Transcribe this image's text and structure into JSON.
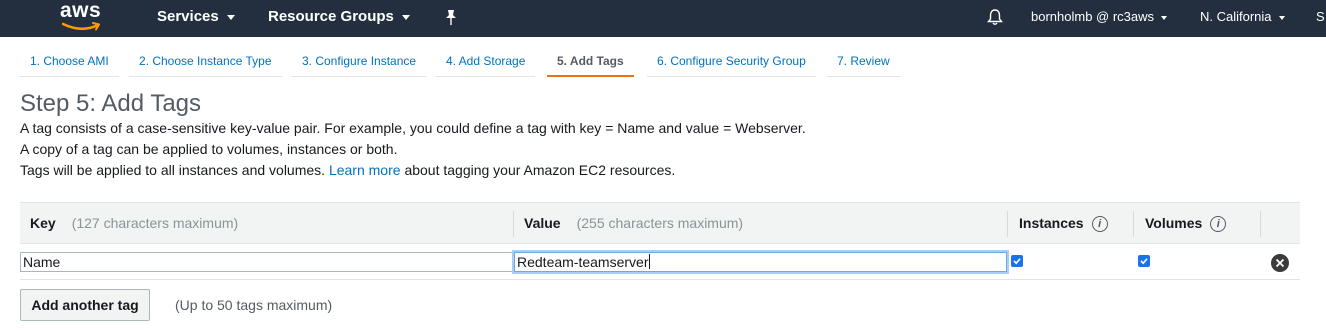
{
  "topnav": {
    "logo_text": "aws",
    "services": "Services",
    "resource_groups": "Resource Groups",
    "account": "bornholmb @ rc3aws",
    "region": "N. California",
    "support_partial": "S"
  },
  "wizard": {
    "steps": [
      {
        "label": "1. Choose AMI"
      },
      {
        "label": "2. Choose Instance Type"
      },
      {
        "label": "3. Configure Instance"
      },
      {
        "label": "4. Add Storage"
      },
      {
        "label": "5. Add Tags"
      },
      {
        "label": "6. Configure Security Group"
      },
      {
        "label": "7. Review"
      }
    ],
    "active_index": 4
  },
  "page": {
    "title": "Step 5: Add Tags",
    "line1": "A tag consists of a case-sensitive key-value pair. For example, you could define a tag with key = Name and value = Webserver.",
    "line2": "A copy of a tag can be applied to volumes, instances or both.",
    "line3_pre": "Tags will be applied to all instances and volumes.",
    "line3_link": "Learn more",
    "line3_post": "about tagging your Amazon EC2 resources."
  },
  "table": {
    "headers": {
      "key": "Key",
      "key_hint": "(127 characters maximum)",
      "value": "Value",
      "value_hint": "(255 characters maximum)",
      "instances": "Instances",
      "volumes": "Volumes"
    },
    "rows": [
      {
        "key": "Name",
        "value": "Redteam-teamserver",
        "instances": true,
        "volumes": true
      }
    ]
  },
  "actions": {
    "add_tag": "Add another tag",
    "add_tag_hint": "(Up to 50 tags maximum)"
  }
}
